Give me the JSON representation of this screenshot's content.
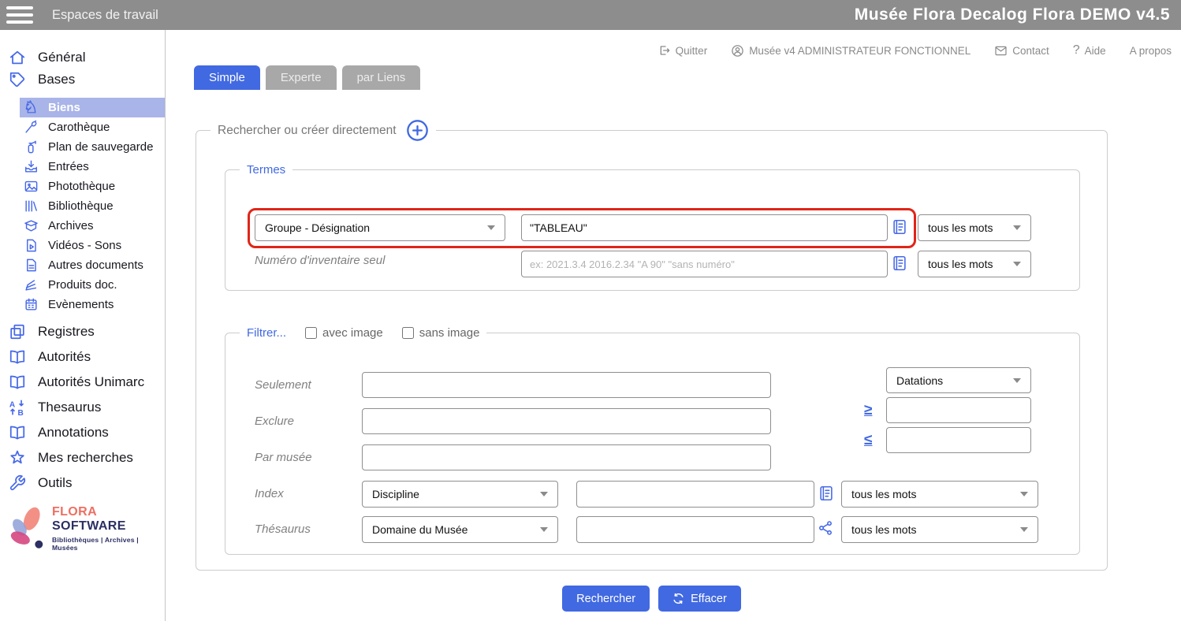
{
  "topbar": {
    "workspace_label": "Espaces de travail",
    "title": "Musée Flora Decalog Flora DEMO v4.5"
  },
  "header_links": {
    "quit": "Quitter",
    "user": "Musée v4 ADMINISTRATEUR FONCTIONNEL",
    "contact": "Contact",
    "help": "Aide",
    "about": "A propos"
  },
  "tabs": [
    {
      "label": "Simple",
      "active": true
    },
    {
      "label": "Experte",
      "active": false
    },
    {
      "label": "par Liens",
      "active": false
    }
  ],
  "sidebar": {
    "items": [
      {
        "label": "Général",
        "icon": "home-icon",
        "level": 0,
        "selected": false
      },
      {
        "label": "Bases",
        "icon": "tag-icon",
        "level": 0,
        "selected": false
      },
      {
        "label": "Biens",
        "icon": "statue-icon",
        "level": 1,
        "selected": true
      },
      {
        "label": "Carothèque",
        "icon": "core-sample-icon",
        "level": 1,
        "selected": false
      },
      {
        "label": "Plan de sauvegarde",
        "icon": "fire-extinguisher-icon",
        "level": 1,
        "selected": false
      },
      {
        "label": "Entrées",
        "icon": "inbox-download-icon",
        "level": 1,
        "selected": false
      },
      {
        "label": "Photothèque",
        "icon": "image-icon",
        "level": 1,
        "selected": false
      },
      {
        "label": "Bibliothèque",
        "icon": "library-icon",
        "level": 1,
        "selected": false
      },
      {
        "label": "Archives",
        "icon": "archive-box-icon",
        "level": 1,
        "selected": false
      },
      {
        "label": "Vidéos - Sons",
        "icon": "video-file-icon",
        "level": 1,
        "selected": false
      },
      {
        "label": "Autres documents",
        "icon": "document-icon",
        "level": 1,
        "selected": false
      },
      {
        "label": "Produits doc.",
        "icon": "pages-fan-icon",
        "level": 1,
        "selected": false
      },
      {
        "label": "Evènements",
        "icon": "calendar-icon",
        "level": 1,
        "selected": false
      },
      {
        "label": "Registres",
        "icon": "registers-icon",
        "level": 0,
        "selected": false
      },
      {
        "label": "Autorités",
        "icon": "open-book-icon",
        "level": 0,
        "selected": false
      },
      {
        "label": "Autorités Unimarc",
        "icon": "open-book-icon",
        "level": 0,
        "selected": false
      },
      {
        "label": "Thesaurus",
        "icon": "sort-alpha-icon",
        "level": 0,
        "selected": false
      },
      {
        "label": "Annotations",
        "icon": "open-book-icon",
        "level": 0,
        "selected": false
      },
      {
        "label": "Mes recherches",
        "icon": "star-icon",
        "level": 0,
        "selected": false
      },
      {
        "label": "Outils",
        "icon": "wrench-icon",
        "level": 0,
        "selected": false
      }
    ],
    "logo": {
      "brand_primary": "FLORA",
      "brand_secondary": "SOFTWARE",
      "tagline": "Bibliothèques | Archives | Musées"
    }
  },
  "search": {
    "legend": "Rechercher ou créer directement",
    "termes": {
      "legend": "Termes",
      "group_select_value": "Groupe - Désignation",
      "term_input_value": "\"TABLEAU\"",
      "term_match_select_value": "tous les mots",
      "inventory_label": "Numéro d'inventaire seul",
      "inventory_placeholder": "ex: 2021.3.4 2016.2.34 \"A 90\" \"sans numéro\"",
      "inventory_match_select_value": "tous les mots"
    },
    "filter": {
      "legend": "Filtrer...",
      "with_image_label": "avec image",
      "without_image_label": "sans image",
      "only_label": "Seulement",
      "exclude_label": "Exclure",
      "by_museum_label": "Par musée",
      "index_label": "Index",
      "index_select_value": "Discipline",
      "index_match_select_value": "tous les mots",
      "thesaurus_label": "Thésaurus",
      "thesaurus_select_value": "Domaine du Musée",
      "thesaurus_match_select_value": "tous les mots",
      "datations_select_value": "Datations",
      "gte_symbol": "≥",
      "lte_symbol": "≤"
    },
    "actions": {
      "search_label": "Rechercher",
      "clear_label": "Effacer"
    }
  },
  "colors": {
    "accent_blue": "#4169e1",
    "sidebar_icon_blue": "#4668e8",
    "topbar_gray": "#8d8d8d",
    "inactive_tab_gray": "#a8a8a8",
    "annotation_red": "#e02517",
    "selected_row_bg": "#a9b4e8",
    "logo_coral": "#ee6f62",
    "logo_navy": "#2b2f63"
  }
}
